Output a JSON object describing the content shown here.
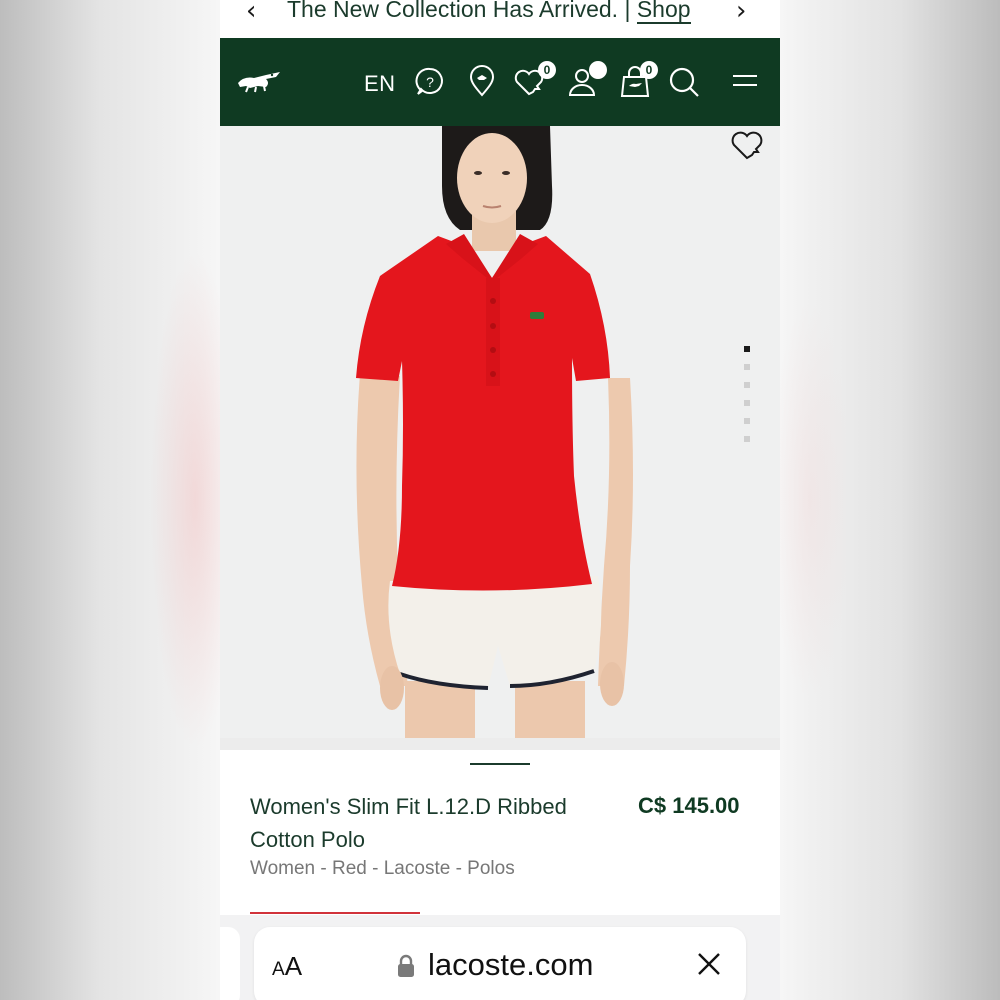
{
  "announcement": {
    "text": "The New Collection Has Arrived. |",
    "link": "Shop",
    "prev_icon": "chevron-left-icon",
    "next_icon": "chevron-right-icon"
  },
  "header": {
    "logo": "crocodile-logo",
    "language": "EN",
    "wishlist_count": "0",
    "cart_count": "0",
    "icons": [
      "help-icon",
      "store-locator-icon",
      "wishlist-icon",
      "account-icon",
      "cart-icon",
      "search-icon",
      "menu-icon"
    ],
    "colors": {
      "brand": "#0f3a22",
      "accent": "#d1323a"
    }
  },
  "gallery": {
    "dots_total": 6,
    "active_index": 0
  },
  "product": {
    "name_line1": "Women's Slim Fit L.12.D Ribbed",
    "name_line2": "Cotton Polo",
    "price": "C$ 145.00",
    "breadcrumbs": "Women - Red - Lacoste - Polos"
  },
  "browser": {
    "text_size_label": "AA",
    "domain": "lacoste.com"
  }
}
